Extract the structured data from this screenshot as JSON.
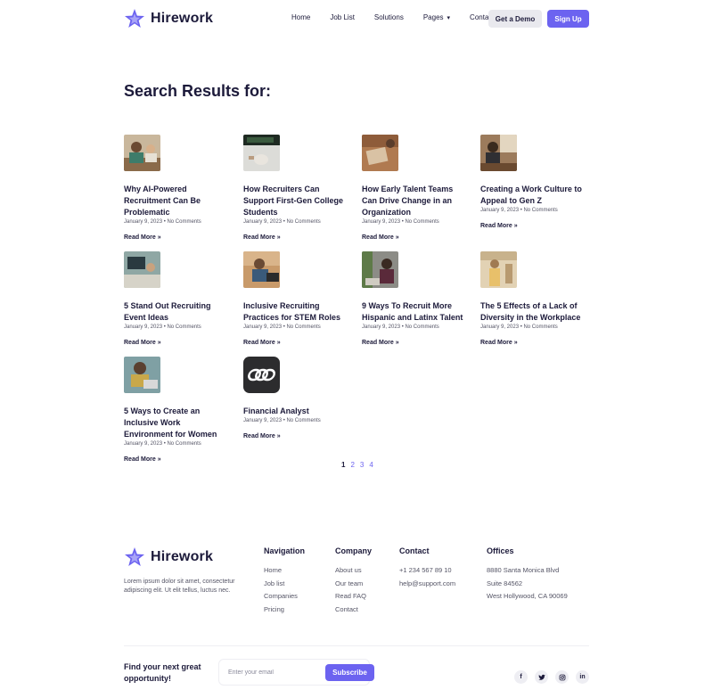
{
  "brand": {
    "name": "Hirework",
    "accent": "#6c63f0",
    "text": "#1c1a3a"
  },
  "nav": {
    "items": [
      "Home",
      "Job List",
      "Solutions",
      "Pages",
      "Contact"
    ],
    "demo_label": "Get a Demo",
    "signup_label": "Sign Up"
  },
  "page_title": "Search Results for:",
  "results": [
    {
      "title": "Why AI-Powered Recruitment Can Be Problematic",
      "meta": "January 9, 2023 • No Comments",
      "more": "Read More »",
      "thumb": "people-photo"
    },
    {
      "title": "How Recruiters Can Support First-Gen College Students",
      "meta": "January 9, 2023 • No Comments",
      "more": "Read More »",
      "thumb": "laptop-photo"
    },
    {
      "title": "How Early Talent Teams Can Drive Change in an Organization",
      "meta": "January 9, 2023 • No Comments",
      "more": "Read More »",
      "thumb": "desk-photo"
    },
    {
      "title": "Creating a Work Culture to Appeal to Gen Z",
      "meta": "January 9, 2023 • No Comments",
      "more": "Read More »",
      "thumb": "office-photo"
    },
    {
      "title": "5 Stand Out Recruiting Event Ideas",
      "meta": "January 9, 2023 • No Comments",
      "more": "Read More »",
      "thumb": "workspace-photo"
    },
    {
      "title": "Inclusive Recruiting Practices for STEM Roles",
      "meta": "January 9, 2023 • No Comments",
      "more": "Read More »",
      "thumb": "engineer-photo"
    },
    {
      "title": "9 Ways To Recruit More Hispanic and Latinx Talent",
      "meta": "January 9, 2023 • No Comments",
      "more": "Read More »",
      "thumb": "meeting-photo"
    },
    {
      "title": "The 5 Effects of a Lack of Diversity in the Workplace",
      "meta": "January 9, 2023 • No Comments",
      "more": "Read More »",
      "thumb": "kitchen-photo"
    },
    {
      "title": "5 Ways to Create an Inclusive Work Environment for Women",
      "meta": "January 9, 2023 • No Comments",
      "more": "Read More »",
      "thumb": "woman-laptop-photo"
    },
    {
      "title": "Financial Analyst",
      "meta": "January 9, 2023 • No Comments",
      "more": "Read More »",
      "thumb": "company-logo"
    }
  ],
  "pagination": [
    "1",
    "2",
    "3",
    "4"
  ],
  "footer": {
    "about": "Lorem ipsum dolor sit amet, consectetur adipiscing elit. Ut elit tellus, luctus nec.",
    "navigation": {
      "heading": "Navigation",
      "links": [
        "Home",
        "Job list",
        "Companies",
        "Pricing"
      ]
    },
    "company": {
      "heading": "Company",
      "links": [
        "About us",
        "Our team",
        "Read FAQ",
        "Contact"
      ]
    },
    "contact": {
      "heading": "Contact",
      "links": [
        "+1 234 567 89 10",
        "help@support.com"
      ]
    },
    "offices": {
      "heading": "Offices",
      "links": [
        "8880 Santa Monica Blvd",
        "Suite 84562",
        "West Hollywood, CA 90069"
      ]
    },
    "newsletter_label": "Find your next great opportunity!",
    "email_placeholder": "Enter your email",
    "subscribe_label": "Subscribe",
    "socials": [
      "facebook-icon",
      "twitter-icon",
      "instagram-icon",
      "linkedin-icon"
    ]
  }
}
